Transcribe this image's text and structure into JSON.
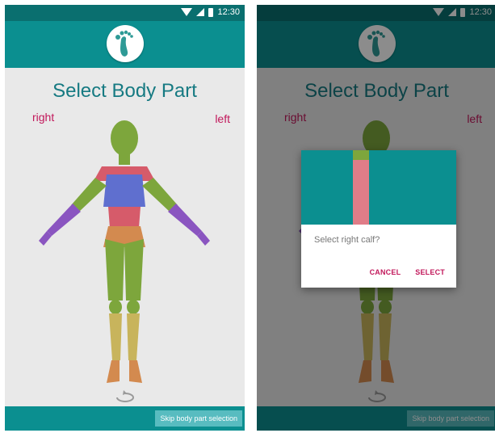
{
  "status": {
    "time": "12:30"
  },
  "screen": {
    "title": "Select Body Part",
    "label_right": "right",
    "label_left": "left",
    "skip_button": "Skip body part selection"
  },
  "dialog": {
    "message": "Select right calf?",
    "cancel": "CANCEL",
    "select": "SELECT"
  },
  "colors": {
    "teal": "#0b8f90",
    "teal_dark": "#0a6f6f",
    "title": "#167a82",
    "accent": "#c2185b",
    "body_green": "#7da63c",
    "body_pink": "#d65b6a",
    "body_blue": "#5f6fcf",
    "body_purple": "#8a55c0",
    "body_orange": "#d38a4f",
    "body_yellow": "#c8b45c"
  },
  "icons": [
    "wifi-icon",
    "signal-icon",
    "battery-icon",
    "footprint-logo-icon",
    "rotate-icon"
  ]
}
